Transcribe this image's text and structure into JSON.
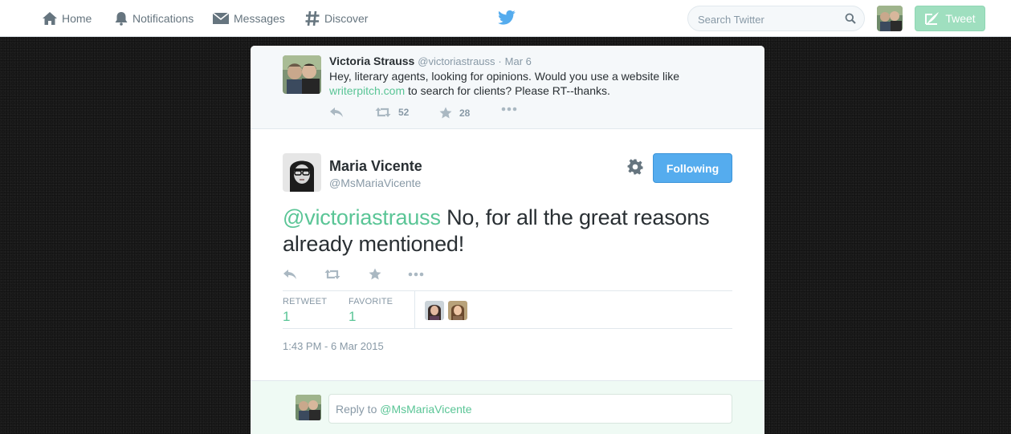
{
  "nav": {
    "home": "Home",
    "notifications": "Notifications",
    "messages": "Messages",
    "discover": "Discover"
  },
  "search": {
    "placeholder": "Search Twitter"
  },
  "tweet_button": "Tweet",
  "colors": {
    "accent": "#5ac596",
    "follow": "#55acee",
    "twitter_blue": "#55acee"
  },
  "parent_tweet": {
    "name": "Victoria Strauss",
    "handle": "@victoriastrauss",
    "separator": "·",
    "date": "Mar 6",
    "text_before": "Hey, literary agents, looking for opinions. Would you use a website like",
    "link": "writerpitch.com",
    "text_after": "to search for clients? Please RT--thanks.",
    "retweets": "52",
    "favorites": "28"
  },
  "main_tweet": {
    "name": "Maria Vicente",
    "handle": "@MsMariaVicente",
    "follow_label": "Following",
    "mention": "@victoriastrauss",
    "text": "No, for all the great reasons already mentioned!",
    "retweet_label": "RETWEET",
    "retweet_count": "1",
    "favorite_label": "FAVORITE",
    "favorite_count": "1",
    "timestamp": "1:43 PM - 6 Mar 2015"
  },
  "reply": {
    "prefix": "Reply to",
    "mention": "@MsMariaVicente"
  }
}
